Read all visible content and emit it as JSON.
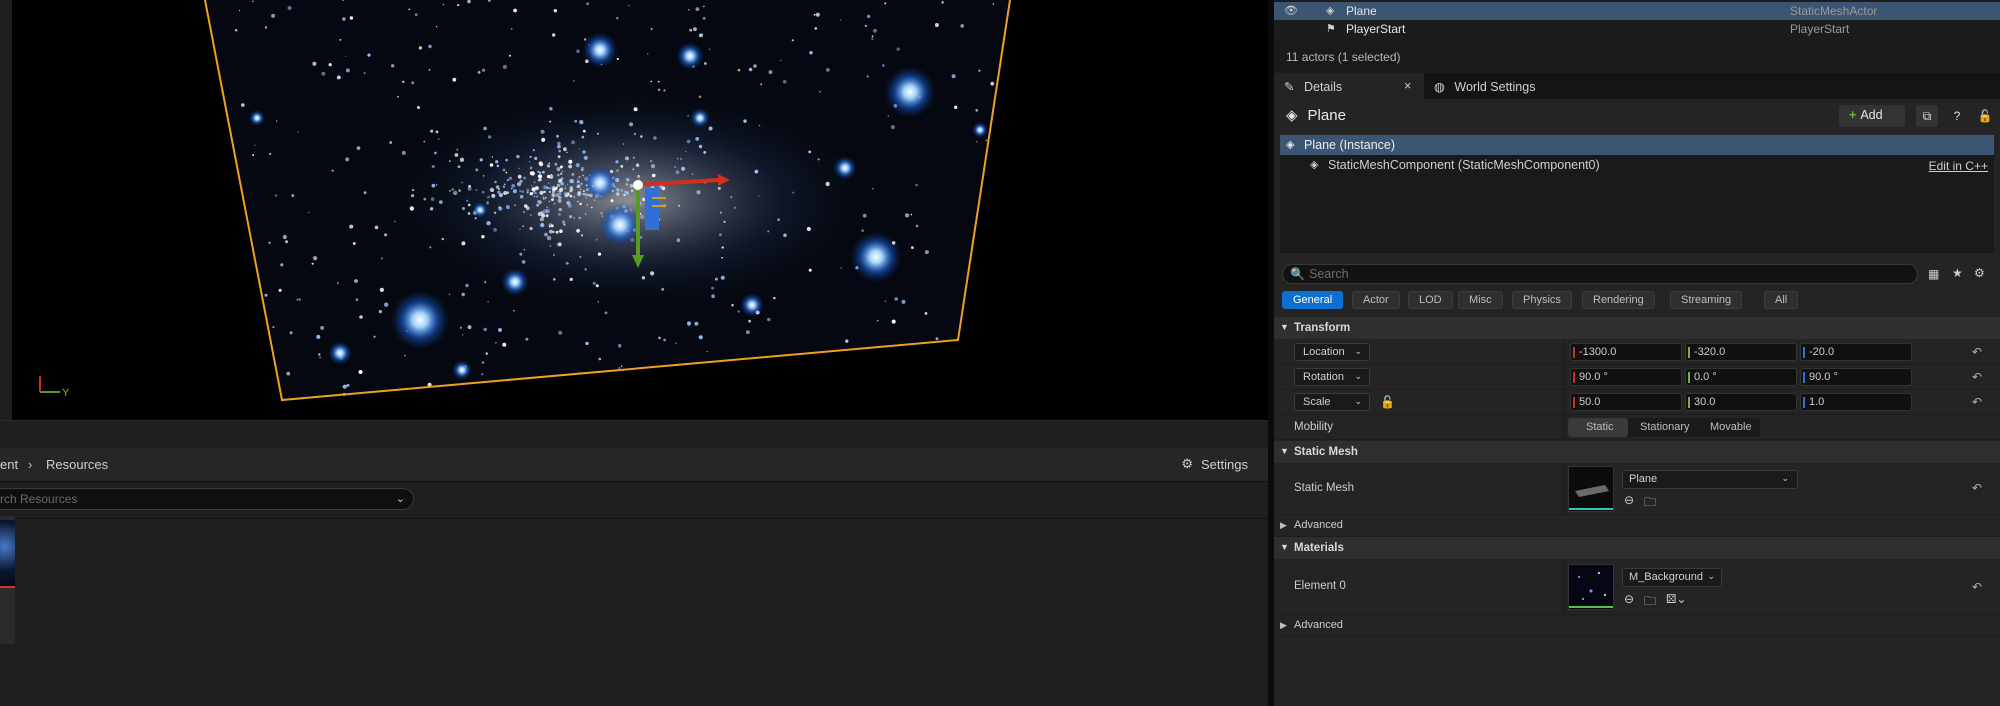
{
  "viewport": {
    "axis_y_label": "Y"
  },
  "content_browser": {
    "breadcrumb_part": "ent",
    "breadcrumb_current": "Resources",
    "settings_label": "Settings",
    "search_placeholder": "rch Resources"
  },
  "outliner": {
    "rows": [
      {
        "name": "Plane",
        "type": "StaticMeshActor",
        "selected": true
      },
      {
        "name": "PlayerStart",
        "type": "PlayerStart",
        "selected": false
      }
    ],
    "count_text": "11 actors (1 selected)"
  },
  "tabs": [
    {
      "label": "Details",
      "close": "×"
    },
    {
      "label": "World Settings"
    }
  ],
  "details": {
    "title": "Plane",
    "add_label": "Add",
    "components": {
      "instance": "Plane (Instance)",
      "child": "StaticMeshComponent (StaticMeshComponent0)",
      "edit_link": "Edit in C++"
    },
    "search_placeholder": "Search",
    "filters": [
      "General",
      "Actor",
      "LOD",
      "Misc",
      "Physics",
      "Rendering",
      "Streaming",
      "All"
    ],
    "active_filter": "General",
    "sections": {
      "transform": "Transform",
      "static_mesh": "Static Mesh",
      "materials": "Materials",
      "advanced": "Advanced"
    },
    "transform": {
      "location": {
        "label": "Location",
        "x": "-1300.0",
        "y": "-320.0",
        "z": "-20.0"
      },
      "rotation": {
        "label": "Rotation",
        "x": "90.0 °",
        "y": "0.0 °",
        "z": "90.0 °"
      },
      "scale": {
        "label": "Scale",
        "x": "50.0",
        "y": "30.0",
        "z": "1.0"
      },
      "mobility_label": "Mobility",
      "mobility_options": [
        "Static",
        "Stationary",
        "Movable"
      ],
      "mobility_selected": "Static"
    },
    "static_mesh": {
      "label": "Static Mesh",
      "value": "Plane"
    },
    "materials": {
      "label": "Element 0",
      "value": "M_Background"
    }
  },
  "colors": {
    "accent": "#0f6fd1",
    "selection": "#3b5572",
    "x_axis": "#c9302c",
    "y_axis": "#7fb13a",
    "z_axis": "#2f6fd6",
    "gizmo_border": "#f0a020"
  }
}
